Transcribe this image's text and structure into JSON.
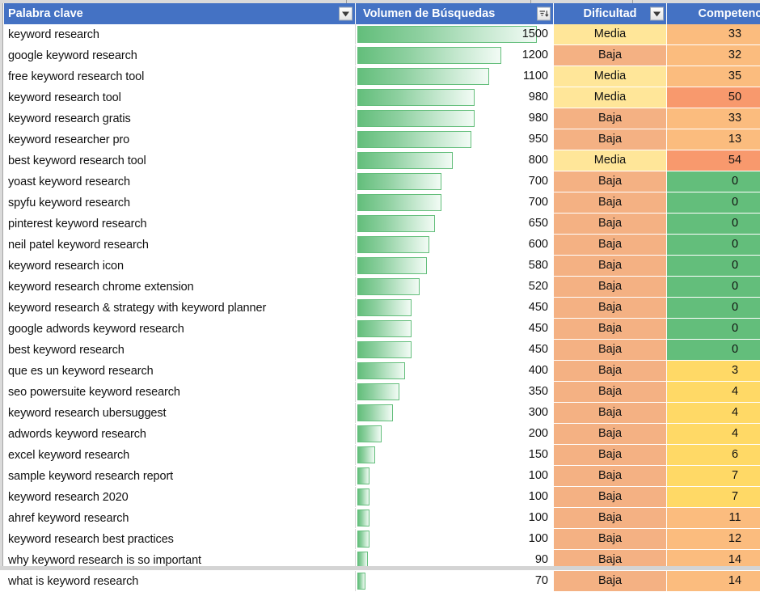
{
  "table": {
    "columns": [
      {
        "key": "keyword",
        "label": "Palabra clave",
        "icon": "filter-dropdown-icon"
      },
      {
        "key": "volume",
        "label": "Volumen de Búsquedas",
        "icon": "sort-descending-icon"
      },
      {
        "key": "difficulty",
        "label": "Dificultad",
        "icon": "filter-dropdown-icon"
      },
      {
        "key": "competition",
        "label": "Competencia",
        "icon": "filter-dropdown-icon"
      }
    ],
    "rows": [
      {
        "keyword": "keyword research",
        "volume": 1500,
        "difficulty": "Media",
        "competition": 33
      },
      {
        "keyword": "google keyword research",
        "volume": 1200,
        "difficulty": "Baja",
        "competition": 32
      },
      {
        "keyword": "free keyword research tool",
        "volume": 1100,
        "difficulty": "Media",
        "competition": 35
      },
      {
        "keyword": "keyword research tool",
        "volume": 980,
        "difficulty": "Media",
        "competition": 50
      },
      {
        "keyword": "keyword research gratis",
        "volume": 980,
        "difficulty": "Baja",
        "competition": 33
      },
      {
        "keyword": "keyword researcher pro",
        "volume": 950,
        "difficulty": "Baja",
        "competition": 13
      },
      {
        "keyword": "best keyword research tool",
        "volume": 800,
        "difficulty": "Media",
        "competition": 54
      },
      {
        "keyword": "yoast keyword research",
        "volume": 700,
        "difficulty": "Baja",
        "competition": 0
      },
      {
        "keyword": "spyfu keyword research",
        "volume": 700,
        "difficulty": "Baja",
        "competition": 0
      },
      {
        "keyword": "pinterest keyword research",
        "volume": 650,
        "difficulty": "Baja",
        "competition": 0
      },
      {
        "keyword": "neil patel keyword research",
        "volume": 600,
        "difficulty": "Baja",
        "competition": 0
      },
      {
        "keyword": "keyword research icon",
        "volume": 580,
        "difficulty": "Baja",
        "competition": 0
      },
      {
        "keyword": "keyword research chrome extension",
        "volume": 520,
        "difficulty": "Baja",
        "competition": 0
      },
      {
        "keyword": "keyword research & strategy with keyword planner",
        "volume": 450,
        "difficulty": "Baja",
        "competition": 0
      },
      {
        "keyword": "google adwords keyword research",
        "volume": 450,
        "difficulty": "Baja",
        "competition": 0
      },
      {
        "keyword": "best keyword research",
        "volume": 450,
        "difficulty": "Baja",
        "competition": 0
      },
      {
        "keyword": "que es un keyword research",
        "volume": 400,
        "difficulty": "Baja",
        "competition": 3
      },
      {
        "keyword": "seo powersuite keyword research",
        "volume": 350,
        "difficulty": "Baja",
        "competition": 4
      },
      {
        "keyword": "keyword research ubersuggest",
        "volume": 300,
        "difficulty": "Baja",
        "competition": 4
      },
      {
        "keyword": "adwords keyword research",
        "volume": 200,
        "difficulty": "Baja",
        "competition": 4
      },
      {
        "keyword": "excel keyword research",
        "volume": 150,
        "difficulty": "Baja",
        "competition": 6
      },
      {
        "keyword": "sample keyword research report",
        "volume": 100,
        "difficulty": "Baja",
        "competition": 7
      },
      {
        "keyword": "keyword research 2020",
        "volume": 100,
        "difficulty": "Baja",
        "competition": 7
      },
      {
        "keyword": "ahref keyword research",
        "volume": 100,
        "difficulty": "Baja",
        "competition": 11
      },
      {
        "keyword": "keyword research best practices",
        "volume": 100,
        "difficulty": "Baja",
        "competition": 12
      },
      {
        "keyword": "why keyword research is so important",
        "volume": 90,
        "difficulty": "Baja",
        "competition": 14
      },
      {
        "keyword": "what is keyword research",
        "volume": 70,
        "difficulty": "Baja",
        "competition": 14
      }
    ]
  },
  "chart_data": {
    "type": "bar",
    "title": "Volumen de Búsquedas",
    "xlabel": "Palabra clave",
    "ylabel": "Volumen de Búsquedas",
    "orientation": "horizontal",
    "max_value": 1500,
    "categories": [
      "keyword research",
      "google keyword research",
      "free keyword research tool",
      "keyword research tool",
      "keyword research gratis",
      "keyword researcher pro",
      "best keyword research tool",
      "yoast keyword research",
      "spyfu keyword research",
      "pinterest keyword research",
      "neil patel keyword research",
      "keyword research icon",
      "keyword research chrome extension",
      "keyword research & strategy with keyword planner",
      "google adwords keyword research",
      "best keyword research",
      "que es un keyword research",
      "seo powersuite keyword research",
      "keyword research ubersuggest",
      "adwords keyword research",
      "excel keyword research",
      "sample keyword research report",
      "keyword research 2020",
      "ahref keyword research",
      "keyword research best practices",
      "why keyword research is so important",
      "what is keyword research"
    ],
    "values": [
      1500,
      1200,
      1100,
      980,
      980,
      950,
      800,
      700,
      700,
      650,
      600,
      580,
      520,
      450,
      450,
      450,
      400,
      350,
      300,
      200,
      150,
      100,
      100,
      100,
      100,
      90,
      70
    ],
    "series": [
      {
        "name": "Competencia",
        "values": [
          33,
          32,
          35,
          50,
          33,
          13,
          54,
          0,
          0,
          0,
          0,
          0,
          0,
          0,
          0,
          0,
          3,
          4,
          4,
          4,
          6,
          7,
          7,
          11,
          12,
          14,
          14
        ]
      }
    ]
  },
  "colors": {
    "header_blue": "#4472c4",
    "bar_green": "#63be7b",
    "difficulty_media": "#ffe699",
    "difficulty_baja": "#f4b183",
    "scale_green": "#63be7b",
    "scale_yellow": "#ffd966",
    "scale_orange": "#fbbc7e",
    "scale_salmon": "#f8996d"
  }
}
